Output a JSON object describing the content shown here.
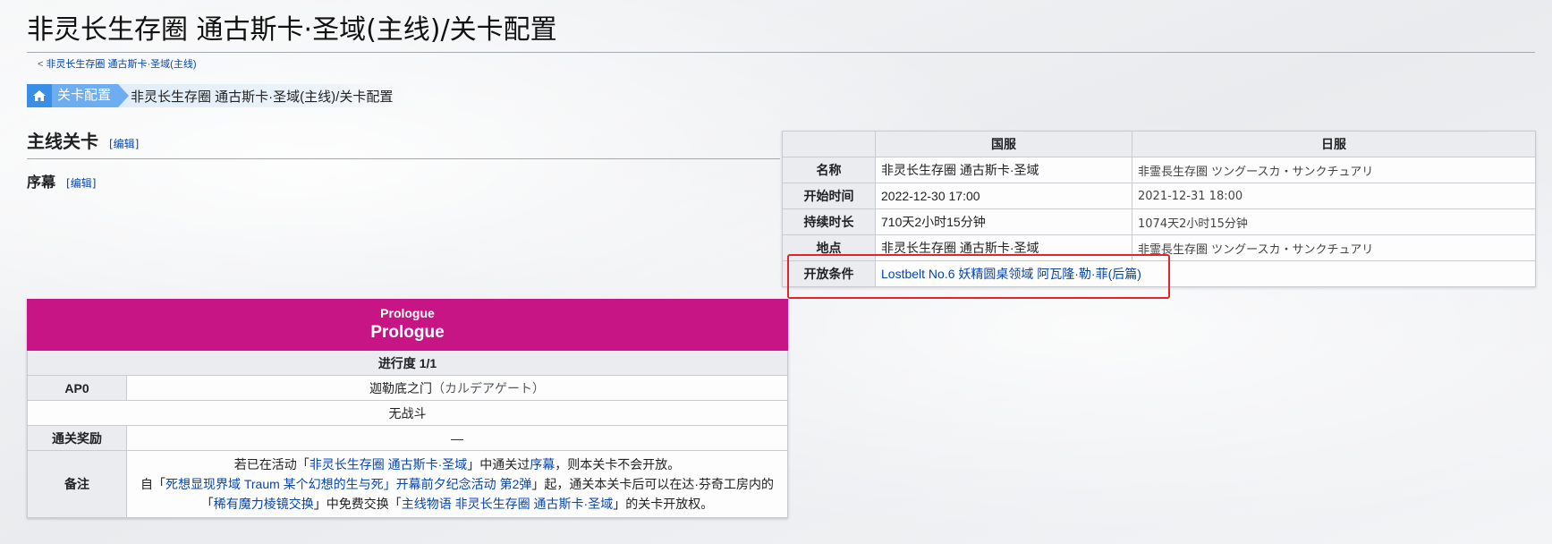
{
  "page": {
    "title": "非灵长生存圈 通古斯卡·圣域(主线)/关卡配置",
    "back_link": "非灵长生存圈 通古斯卡·圣域(主线)"
  },
  "breadcrumb": {
    "segment": "关卡配置",
    "current": "非灵长生存圈 通古斯卡·圣域(主线)/关卡配置"
  },
  "section": {
    "heading": "主线关卡",
    "edit": "[编辑]",
    "subheading": "序幕",
    "sub_edit": "[编辑]"
  },
  "info_table": {
    "headers": [
      "",
      "国服",
      "日服"
    ],
    "rows": [
      {
        "label": "名称",
        "cn": "非灵长生存圈 通古斯卡·圣域",
        "jp": "非霊長生存圏 ツングースカ・サンクチュアリ"
      },
      {
        "label": "开始时间",
        "cn": "2022-12-30 17:00",
        "jp": "2021-12-31 18:00"
      },
      {
        "label": "持续时长",
        "cn": "710天2小时15分钟",
        "jp": "1074天2小时15分钟"
      },
      {
        "label": "地点",
        "cn": "非灵长生存圈 通古斯卡·圣域",
        "jp": "非霊長生存圏 ツングースカ・サンクチュアリ"
      }
    ],
    "open_condition": {
      "label": "开放条件",
      "link": "Lostbelt No.6 妖精圆桌领域 阿瓦隆·勒·菲(后篇)"
    },
    "highlight_color": "#e5232b"
  },
  "prologue_table": {
    "header_small": "Prologue",
    "header_large": "Prologue",
    "header_color": "#c71585",
    "progress": "进行度 1/1",
    "ap_label": "AP0",
    "location_prefix": "迦勒底之门",
    "location_suffix": "（カルデアゲート）",
    "battle": "无战斗",
    "reward_label": "通关奖励",
    "reward_value": "—",
    "notes_label": "备注",
    "note1": {
      "pre": "若已在活动「",
      "link1": "非灵长生存圈 通古斯卡·圣域",
      "mid": "」中通关过",
      "link2": "序幕",
      "post": "，则本关卡不会开放。"
    },
    "note2": {
      "pre": "自「",
      "link1": "死想显现界域 Traum 某个幻想的生与死」开幕前夕纪念活动 第2弹",
      "mid": "」起，通关本关卡后可以在达·芬奇工房内的「",
      "link2": "稀有魔力棱镜交换",
      "mid2": "」中免费交换「",
      "link3": "主线物语 非灵长生存圈 通古斯卡·圣域",
      "post": "」的关卡开放权。"
    }
  }
}
